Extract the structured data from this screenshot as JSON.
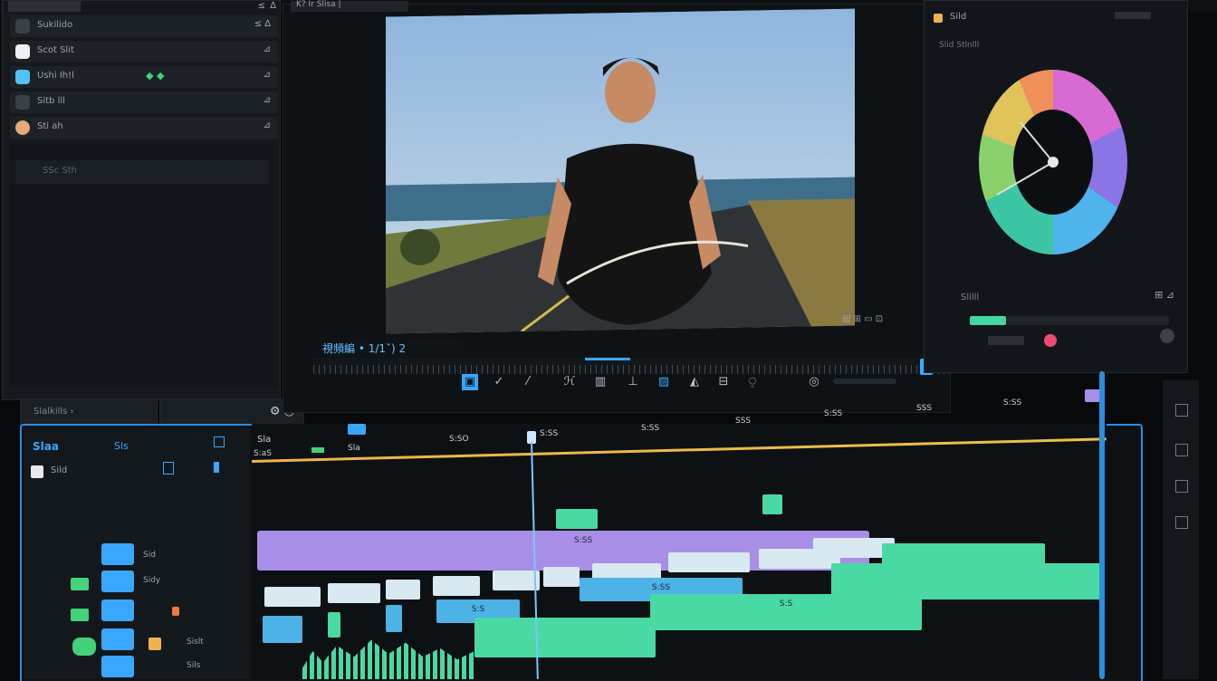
{
  "project_panel": {
    "header_icons": [
      "pin-icon",
      "close-icon"
    ],
    "rows": [
      {
        "label": "Sukilido",
        "icon": "folder-icon",
        "color": "#3a4148",
        "right": "≤  ∆"
      },
      {
        "label": "Scot Slit",
        "icon": "app-icon",
        "color": "#f2f2f2",
        "right": "⊿"
      },
      {
        "label": "Ushi Ih!l",
        "icon": "media-icon",
        "color": "#4fc3f7",
        "right": "⊿"
      },
      {
        "label": "Sitb lll",
        "icon": "audio-icon",
        "color": "#3a4148",
        "right": "⊿"
      },
      {
        "label": "Sti ah",
        "icon": "user-icon",
        "color": "#e8a878",
        "right": "⊿"
      }
    ],
    "search_placeholder": "SSc Sth"
  },
  "viewer": {
    "tab_title": "K? Ir Slisa |",
    "timecode_label": "視頻編 • 1/1ˇ) 2",
    "sub_controls": "▤ ⊞  ▭  ⊡"
  },
  "color_panel": {
    "header": "Sild",
    "sub_header": "Slid Stlnlll",
    "section_label": "Slilll",
    "right_icons": "⊞  ⊿"
  },
  "bottom_left": {
    "search": "Slalkills ›",
    "icons": "⚙  ◷"
  },
  "tools": {
    "items": [
      {
        "glyph": "▣",
        "name": "select-tool-icon"
      },
      {
        "glyph": "✓",
        "name": "check-tool-icon"
      },
      {
        "glyph": "⁄",
        "name": "razor-tool-icon"
      },
      {
        "glyph": "ℋ",
        "name": "hand-tool-icon"
      },
      {
        "glyph": "▥",
        "name": "trim-tool-icon"
      },
      {
        "glyph": "⊥",
        "name": "slip-tool-icon"
      },
      {
        "glyph": "▨",
        "name": "clip-tool-icon"
      },
      {
        "glyph": "◭",
        "name": "marker-tool-icon"
      },
      {
        "glyph": "⊟",
        "name": "snap-tool-icon"
      },
      {
        "glyph": "⍜",
        "name": "link-tool-icon"
      },
      {
        "glyph": "◎",
        "name": "zoom-tool-icon"
      }
    ]
  },
  "timeline": {
    "header_labels": [
      "Slaa",
      "Sls"
    ],
    "ruler": [
      "Sla",
      "S:aS",
      "Sla",
      "S:SO",
      "S:SS",
      "S:SS",
      "SSS",
      "S:SS",
      "SSS",
      "S:SS"
    ],
    "track_labels": [
      "Sild",
      "Sid",
      "Sidy",
      "Sislt",
      "Sils"
    ],
    "clip_labels": {
      "purple": "S:SS",
      "blue_main": "S:SS",
      "blue_2": "S:S",
      "green_main": "S:S"
    }
  },
  "colors": {
    "accent_blue": "#3aa7ff",
    "purple": "#a98ee8",
    "green": "#49d9a3",
    "light": "#d9e9f2",
    "orange": "#f0b24a"
  }
}
